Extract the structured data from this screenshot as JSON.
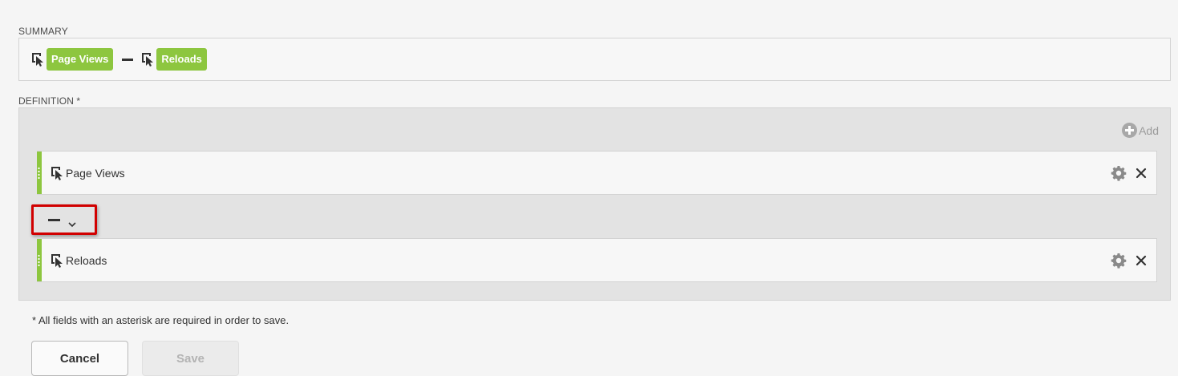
{
  "summary": {
    "label": "SUMMARY",
    "metric_a": "Page Views",
    "operator_icon": "minus-icon",
    "metric_b": "Reloads"
  },
  "definition": {
    "label": "DEFINITION *",
    "add_label": "Add",
    "rows": [
      {
        "label": "Page Views"
      },
      {
        "label": "Reloads"
      }
    ],
    "operator": {
      "icon": "minus-icon",
      "dropdown_icon": "chevron-down-icon"
    }
  },
  "footer": {
    "required_note": "* All fields with an asterisk are required in order to save.",
    "cancel_label": "Cancel",
    "save_label": "Save"
  },
  "colors": {
    "accent_green": "#8dc63f",
    "highlight_red": "#d10000",
    "panel_gray": "#e3e3e3"
  }
}
